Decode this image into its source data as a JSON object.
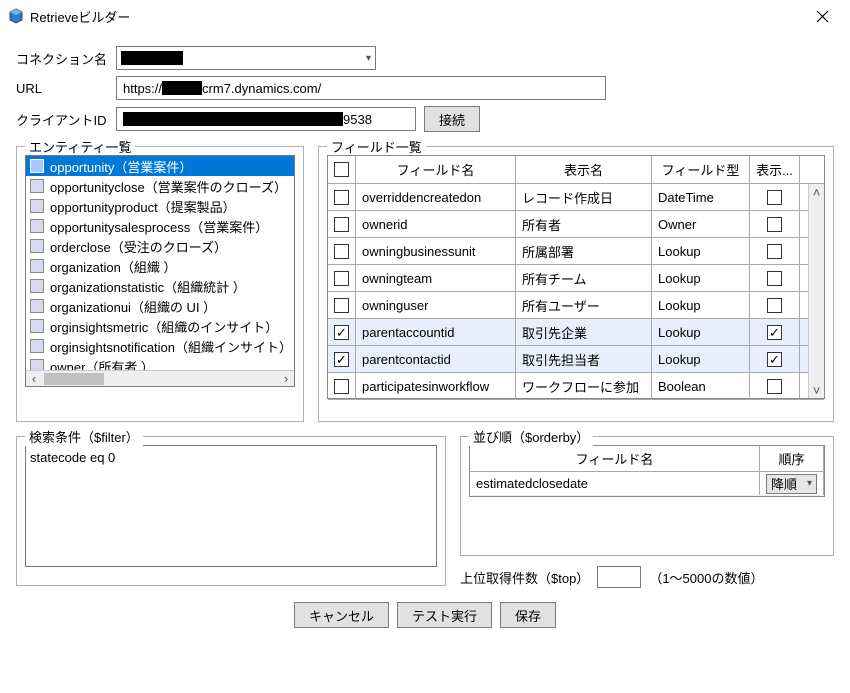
{
  "titlebar": {
    "title": "Retrieveビルダー"
  },
  "form": {
    "connection_label": "コネクション名",
    "url_label": "URL",
    "url_value_prefix": "https://",
    "url_value_suffix": "crm7.dynamics.com/",
    "client_label": "クライアントID",
    "client_value_suffix": "9538",
    "connect_btn": "接続"
  },
  "entities": {
    "legend": "エンティティ一覧",
    "items": [
      "opportunity（営業案件）",
      "opportunityclose（営業案件のクローズ）",
      "opportunityproduct（提案製品）",
      "opportunitysalesprocess（営業案件）",
      "orderclose（受注のクローズ）",
      "organization（組織 ）",
      "organizationstatistic（組織統計 ）",
      "organizationui（組織の UI ）",
      "orginsightsmetric（組織のインサイト）",
      "orginsightsnotification（組織インサイト）",
      "owner（所有者 ）"
    ],
    "selected_index": 0
  },
  "fields": {
    "legend": "フィールド一覧",
    "columns": {
      "name": "フィールド名",
      "display": "表示名",
      "type": "フィールド型",
      "show": "表示..."
    },
    "rows": [
      {
        "checked": false,
        "name": "overriddencreatedon",
        "display": "レコード作成日",
        "type": "DateTime",
        "show": false
      },
      {
        "checked": false,
        "name": "ownerid",
        "display": "所有者",
        "type": "Owner",
        "show": false
      },
      {
        "checked": false,
        "name": "owningbusinessunit",
        "display": "所属部署",
        "type": "Lookup",
        "show": false
      },
      {
        "checked": false,
        "name": "owningteam",
        "display": "所有チーム",
        "type": "Lookup",
        "show": false
      },
      {
        "checked": false,
        "name": "owninguser",
        "display": "所有ユーザー",
        "type": "Lookup",
        "show": false
      },
      {
        "checked": true,
        "name": "parentaccountid",
        "display": "取引先企業",
        "type": "Lookup",
        "show": true
      },
      {
        "checked": true,
        "name": "parentcontactid",
        "display": "取引先担当者",
        "type": "Lookup",
        "show": true
      },
      {
        "checked": false,
        "name": "participatesinworkflow",
        "display": "ワークフローに参加",
        "type": "Boolean",
        "show": false
      }
    ]
  },
  "filter": {
    "legend": "検索条件（$filter）",
    "value": "statecode eq 0"
  },
  "orderby": {
    "legend": "並び順（$orderby）",
    "columns": {
      "name": "フィールド名",
      "direction": "順序"
    },
    "rows": [
      {
        "name": "estimatedclosedate",
        "direction": "降順"
      }
    ]
  },
  "top": {
    "label": "上位取得件数（$top）",
    "hint": "（1～5000の数値）",
    "value": ""
  },
  "footer": {
    "cancel": "キャンセル",
    "test": "テスト実行",
    "save": "保存"
  }
}
